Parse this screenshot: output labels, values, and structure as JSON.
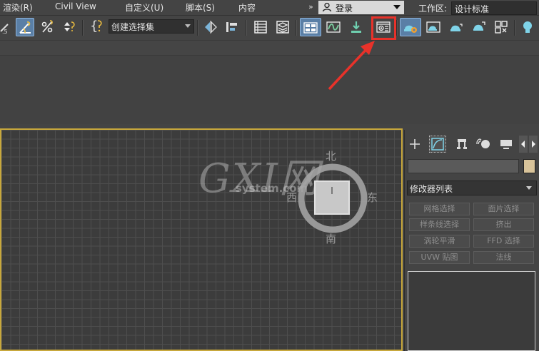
{
  "menu": {
    "items": [
      "渲染(R)",
      "Civil View",
      "自定义(U)",
      "脚本(S)",
      "内容"
    ],
    "expand_glyph": "»",
    "login_label": "登录",
    "workspace_label": "工作区:",
    "workspace_value": "设计标准"
  },
  "toolbar": {
    "selection_set_value": "创建选择集",
    "curly_brace_glyph": "{",
    "icons": [
      "scale-icon",
      "angle-snap-icon",
      "percent-snap-icon",
      "spinner-snap-icon",
      "edit-named-selection-icon",
      "mirror-icon",
      "align-icon",
      "scene-explorer-icon",
      "layer-explorer-icon",
      "toggle-ribbon-icon",
      "curve-editor-icon",
      "schematic-view-icon",
      "render-setup-icon",
      "rendered-frame-window-icon",
      "render-production-icon",
      "render-iterative-icon",
      "render-activeshade-icon",
      "render-online-icon",
      "mental-ray-icon"
    ]
  },
  "viewport": {
    "watermark_main": "GXI网",
    "watermark_sub": "system.com",
    "compass": {
      "north": "北",
      "south": "南",
      "east": "东",
      "west": "西"
    }
  },
  "command_panel": {
    "tabs": [
      "create-tab",
      "modify-tab",
      "hierarchy-tab",
      "motion-tab",
      "display-tab"
    ],
    "modifier_list_label": "修改器列表",
    "modifier_buttons": [
      "网格选择",
      "面片选择",
      "样条线选择",
      "挤出",
      "涡轮平滑",
      "FFD 选择",
      "UVW 贴图",
      "法线"
    ]
  },
  "colors": {
    "highlight_red": "#e8322a",
    "active_blue": "#5a7fa6",
    "viewport_border": "#c8a83c",
    "swatch": "#d8c39a"
  }
}
